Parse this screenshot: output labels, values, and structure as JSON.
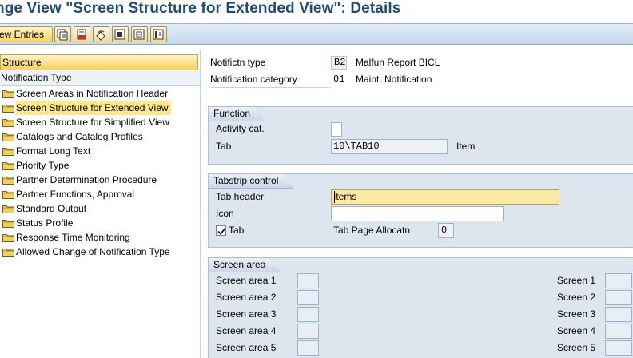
{
  "window": {
    "title": "nge View \"Screen Structure for Extended View\": Details"
  },
  "toolbar": {
    "new_entries_label": "ew Entries",
    "icons": [
      "copy-as-icon",
      "delete-icon",
      "undo-change-icon",
      "select-all-icon",
      "select-block-icon",
      "deselect-all-icon"
    ]
  },
  "tree": {
    "header": "Structure",
    "root": "Notification Type",
    "items": [
      {
        "label": "Screen Areas in Notification Header",
        "selected": false
      },
      {
        "label": "Screen Structure for Extended View",
        "selected": true
      },
      {
        "label": "Screen Structure for Simplified View",
        "selected": false
      },
      {
        "label": "Catalogs and Catalog Profiles",
        "selected": false
      },
      {
        "label": "Format Long Text",
        "selected": false
      },
      {
        "label": "Priority Type",
        "selected": false
      },
      {
        "label": "Partner Determination Procedure",
        "selected": false
      },
      {
        "label": "Partner Functions, Approval",
        "selected": false
      },
      {
        "label": "Standard Output",
        "selected": false
      },
      {
        "label": "Status Profile",
        "selected": false
      },
      {
        "label": "Response Time Monitoring",
        "selected": false
      },
      {
        "label": "Allowed Change of Notification Type",
        "selected": false
      }
    ]
  },
  "header_fields": {
    "notif_type_label": "Notifictn type",
    "notif_type_value": "B2",
    "notif_type_desc": "Malfun Report BICL",
    "notif_cat_label": "Notification category",
    "notif_cat_value": "01",
    "notif_cat_desc": "Maint. Notification"
  },
  "function_group": {
    "title": "Function",
    "activity_cat_label": "Activity cat.",
    "activity_cat_value": "",
    "tab_label": "Tab",
    "tab_value": "10\\TAB10",
    "tab_desc": "Item"
  },
  "tabstrip_group": {
    "title": "Tabstrip control",
    "tab_header_label": "Tab header",
    "tab_header_value": "Items",
    "icon_label": "Icon",
    "icon_value": "",
    "tab_checkbox_label": "Tab",
    "tab_checked": true,
    "tab_page_alloc_label": "Tab Page Allocatn",
    "tab_page_alloc_value": "0"
  },
  "screen_area_group": {
    "title": "Screen area",
    "left_labels": [
      "Screen area 1",
      "Screen area 2",
      "Screen area 3",
      "Screen area 4",
      "Screen area 5"
    ],
    "right_labels": [
      "Screen 1",
      "Screen 2",
      "Screen 3",
      "Screen 4",
      "Screen 5"
    ]
  },
  "colors": {
    "title": "#1f4a80",
    "selection": "#fde98c",
    "group_bg": "#dde5ef"
  }
}
